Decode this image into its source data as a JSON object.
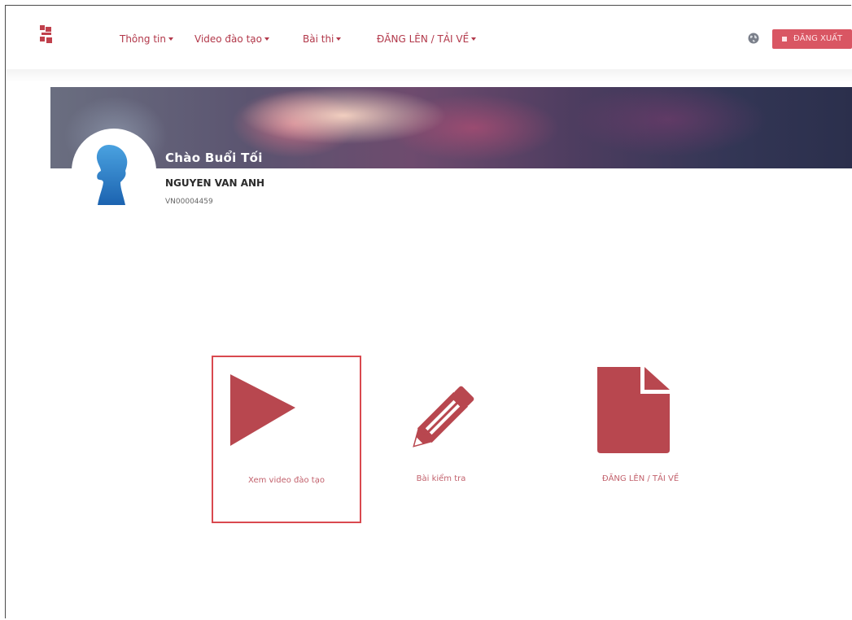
{
  "nav": {
    "items": [
      {
        "label": "Thông tin"
      },
      {
        "label": "Video đào tạo"
      },
      {
        "label": "Bài thi"
      },
      {
        "label": "ĐĂNG LÊN / TẢI VỀ"
      }
    ],
    "logout_label": "ĐĂNG XUẤT"
  },
  "profile": {
    "greeting": "Chào Buổi Tối",
    "name": "NGUYEN VAN ANH",
    "id": "VN00004459"
  },
  "tiles": [
    {
      "label": "Xem video đào tạo",
      "icon": "play-icon",
      "selected": true
    },
    {
      "label": "Bài kiểm tra",
      "icon": "pencil-icon",
      "selected": false
    },
    {
      "label": "ĐĂNG LÊN / TẢI VỀ",
      "icon": "document-icon",
      "selected": false
    }
  ],
  "colors": {
    "accent": "#b2384a",
    "icon_fill": "#b8474f",
    "logout_bg": "#d95663",
    "selected_border": "#d9494f"
  }
}
